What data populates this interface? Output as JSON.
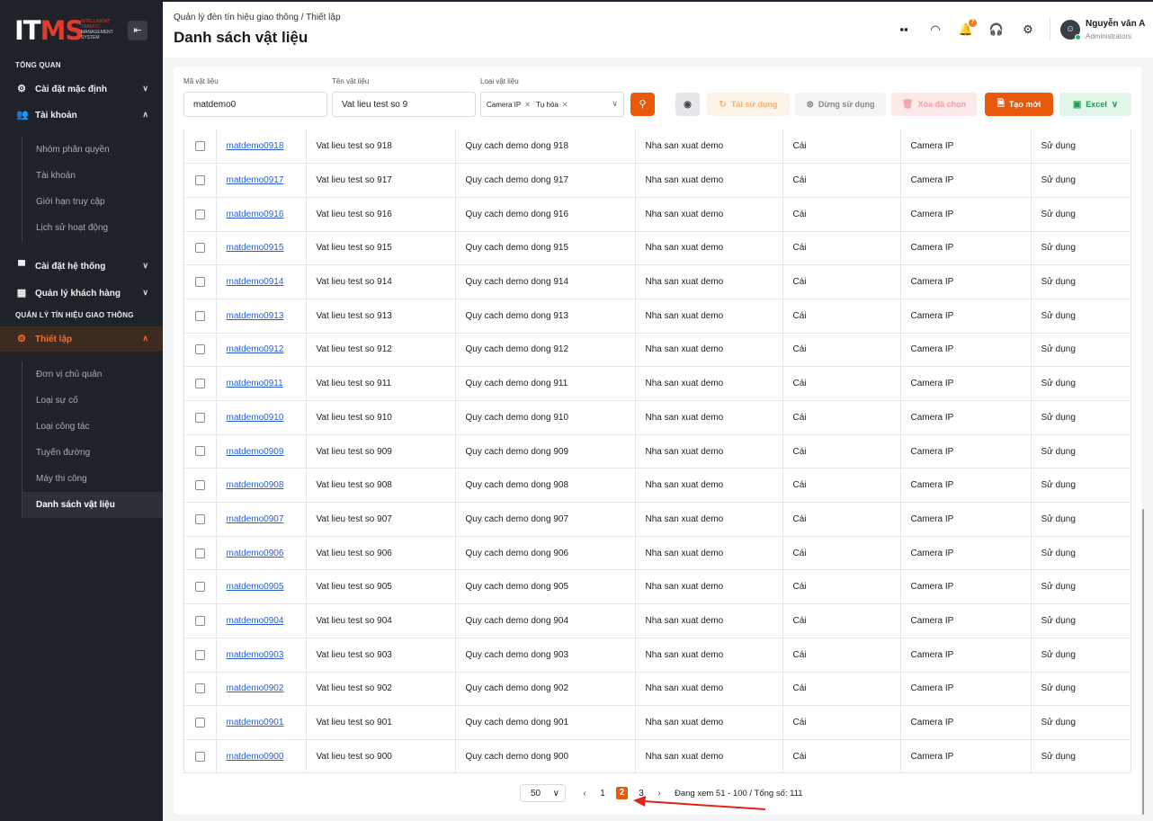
{
  "brand": {
    "logo_main": "IT",
    "logo_accent": "MS",
    "logo_sub": [
      "INTELLIGENT",
      "TRAFFIC",
      "MANAGEMENT",
      "SYSTEM"
    ]
  },
  "sidebar": {
    "section_overview": "TỔNG QUAN",
    "item_default_settings": "Cài đặt mặc định",
    "item_accounts": "Tài khoản",
    "accounts_sub": [
      "Nhóm phân quyền",
      "Tài khoản",
      "Giới hạn truy cập",
      "Lịch sử hoạt động"
    ],
    "item_system_settings": "Cài đặt hệ thống",
    "item_customers": "Quản lý khách hàng",
    "section_signals": "QUẢN LÝ TÍN HIỆU GIAO THÔNG",
    "item_setup": "Thiết lập",
    "setup_sub": [
      "Đơn vị chủ quản",
      "Loại sự cố",
      "Loại công tác",
      "Tuyến đường",
      "Máy thi công",
      "Danh sách vật liệu"
    ]
  },
  "header": {
    "breadcrumb": "Quản lý đèn tín hiệu giao thông  /  Thiết lập",
    "title": "Danh sách vật liệu",
    "notif_count": "7",
    "user_name": "Nguyễn văn A",
    "user_role": "Administrators"
  },
  "filters": {
    "code_label": "Mã vật liệu",
    "code_value": "matdemo0",
    "name_label": "Tên vật liệu",
    "name_value": "Vat lieu test so 9",
    "type_label": "Loại vật liệu",
    "type_tags": [
      "Camera IP",
      "Tụ hóa"
    ]
  },
  "toolbar": {
    "reuse": "Tái sử dụng",
    "stop": "Dừng sử dụng",
    "delete": "Xóa đã chọn",
    "create": "Tạo mới",
    "excel": "Excel"
  },
  "rows": [
    [
      "matdemo0918",
      "Vat lieu test so 918",
      "Quy cach demo dong 918",
      "Nha san xuat demo",
      "Cái",
      "Camera IP",
      "Sử dụng"
    ],
    [
      "matdemo0917",
      "Vat lieu test so 917",
      "Quy cach demo dong 917",
      "Nha san xuat demo",
      "Cái",
      "Camera IP",
      "Sử dụng"
    ],
    [
      "matdemo0916",
      "Vat lieu test so 916",
      "Quy cach demo dong 916",
      "Nha san xuat demo",
      "Cái",
      "Camera IP",
      "Sử dụng"
    ],
    [
      "matdemo0915",
      "Vat lieu test so 915",
      "Quy cach demo dong 915",
      "Nha san xuat demo",
      "Cái",
      "Camera IP",
      "Sử dụng"
    ],
    [
      "matdemo0914",
      "Vat lieu test so 914",
      "Quy cach demo dong 914",
      "Nha san xuat demo",
      "Cái",
      "Camera IP",
      "Sử dụng"
    ],
    [
      "matdemo0913",
      "Vat lieu test so 913",
      "Quy cach demo dong 913",
      "Nha san xuat demo",
      "Cái",
      "Camera IP",
      "Sử dụng"
    ],
    [
      "matdemo0912",
      "Vat lieu test so 912",
      "Quy cach demo dong 912",
      "Nha san xuat demo",
      "Cái",
      "Camera IP",
      "Sử dụng"
    ],
    [
      "matdemo0911",
      "Vat lieu test so 911",
      "Quy cach demo dong 911",
      "Nha san xuat demo",
      "Cái",
      "Camera IP",
      "Sử dụng"
    ],
    [
      "matdemo0910",
      "Vat lieu test so 910",
      "Quy cach demo dong 910",
      "Nha san xuat demo",
      "Cái",
      "Camera IP",
      "Sử dụng"
    ],
    [
      "matdemo0909",
      "Vat lieu test so 909",
      "Quy cach demo dong 909",
      "Nha san xuat demo",
      "Cái",
      "Camera IP",
      "Sử dụng"
    ],
    [
      "matdemo0908",
      "Vat lieu test so 908",
      "Quy cach demo dong 908",
      "Nha san xuat demo",
      "Cái",
      "Camera IP",
      "Sử dụng"
    ],
    [
      "matdemo0907",
      "Vat lieu test so 907",
      "Quy cach demo dong 907",
      "Nha san xuat demo",
      "Cái",
      "Camera IP",
      "Sử dụng"
    ],
    [
      "matdemo0906",
      "Vat lieu test so 906",
      "Quy cach demo dong 906",
      "Nha san xuat demo",
      "Cái",
      "Camera IP",
      "Sử dụng"
    ],
    [
      "matdemo0905",
      "Vat lieu test so 905",
      "Quy cach demo dong 905",
      "Nha san xuat demo",
      "Cái",
      "Camera IP",
      "Sử dụng"
    ],
    [
      "matdemo0904",
      "Vat lieu test so 904",
      "Quy cach demo dong 904",
      "Nha san xuat demo",
      "Cái",
      "Camera IP",
      "Sử dụng"
    ],
    [
      "matdemo0903",
      "Vat lieu test so 903",
      "Quy cach demo dong 903",
      "Nha san xuat demo",
      "Cái",
      "Camera IP",
      "Sử dụng"
    ],
    [
      "matdemo0902",
      "Vat lieu test so 902",
      "Quy cach demo dong 902",
      "Nha san xuat demo",
      "Cái",
      "Camera IP",
      "Sử dụng"
    ],
    [
      "matdemo0901",
      "Vat lieu test so 901",
      "Quy cach demo dong 901",
      "Nha san xuat demo",
      "Cái",
      "Camera IP",
      "Sử dụng"
    ],
    [
      "matdemo0900",
      "Vat lieu test so 900",
      "Quy cach demo dong 900",
      "Nha san xuat demo",
      "Cái",
      "Camera IP",
      "Sử dụng"
    ]
  ],
  "pagination": {
    "page_size": "50",
    "pages": [
      "1",
      "2",
      "3"
    ],
    "current": "2",
    "info": "Đang xem 51 - 100 / Tổng số: 111"
  },
  "colors": {
    "accent": "#e8590c",
    "sidebar_bg": "#1f2329",
    "link": "#2b5fd1",
    "annotation_arrow": "#e0241b"
  }
}
